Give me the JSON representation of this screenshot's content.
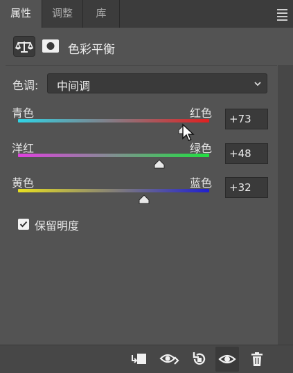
{
  "tabs": [
    {
      "label": "属性",
      "active": true
    },
    {
      "label": "调整",
      "active": false
    },
    {
      "label": "库",
      "active": false
    }
  ],
  "header": {
    "title": "色彩平衡",
    "icons": [
      "balance-scale-icon",
      "mask-icon"
    ]
  },
  "tone": {
    "label": "色调:",
    "value": "中间调"
  },
  "sliders": [
    {
      "left": "青色",
      "right": "红色",
      "value": "+73",
      "level": 73
    },
    {
      "left": "洋红",
      "right": "绿色",
      "value": "+48",
      "level": 48
    },
    {
      "left": "黄色",
      "right": "蓝色",
      "value": "+32",
      "level": 32
    }
  ],
  "preserve": {
    "label": "保留明度",
    "checked": true
  },
  "colors": {
    "background": "#535353",
    "tab_bar": "#3c3c3c",
    "field": "#3a3a3a",
    "cyan_red": [
      "#2fd4e6",
      "#e02020"
    ],
    "magenta_green": [
      "#e040e0",
      "#20e040"
    ],
    "yellow_blue": [
      "#e8e020",
      "#2020d0"
    ]
  },
  "bottom_icons": [
    "clip-to-layer-icon",
    "view-previous-state-icon",
    "reset-icon",
    "visibility-eye-icon",
    "trash-icon"
  ]
}
